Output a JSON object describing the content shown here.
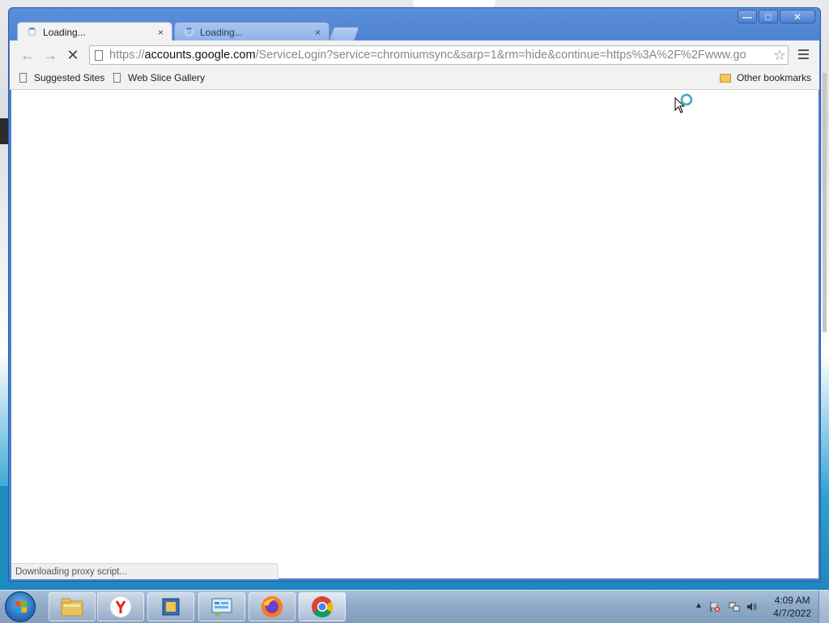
{
  "window": {
    "minimize_glyph": "—",
    "maximize_glyph": "□",
    "close_glyph": "✕"
  },
  "tabs": [
    {
      "title": "Loading...",
      "close_glyph": "×"
    },
    {
      "title": "Loading...",
      "close_glyph": "×"
    }
  ],
  "toolbar": {
    "back_glyph": "←",
    "forward_glyph": "→",
    "stop_glyph": "✕",
    "url_scheme": "https://",
    "url_host": "accounts.google.com",
    "url_rest": "/ServiceLogin?service=chromiumsync&sarp=1&rm=hide&continue=https%3A%2F%2Fwww.go",
    "star_glyph": "☆"
  },
  "bookmarks": {
    "items": [
      {
        "label": "Suggested Sites"
      },
      {
        "label": "Web Slice Gallery"
      }
    ],
    "other_label": "Other bookmarks"
  },
  "status": {
    "text": "Downloading proxy script..."
  },
  "taskbar": {
    "clock_time": "4:09 AM",
    "clock_date": "4/7/2022",
    "apps": [
      "file-explorer",
      "yandex-browser",
      "virtualbox",
      "control-panel",
      "firefox",
      "chrome"
    ],
    "tray_arrow": "▲"
  },
  "colors": {
    "title_bar": "#4f83d2",
    "taskbar": "#8ea9c8"
  }
}
